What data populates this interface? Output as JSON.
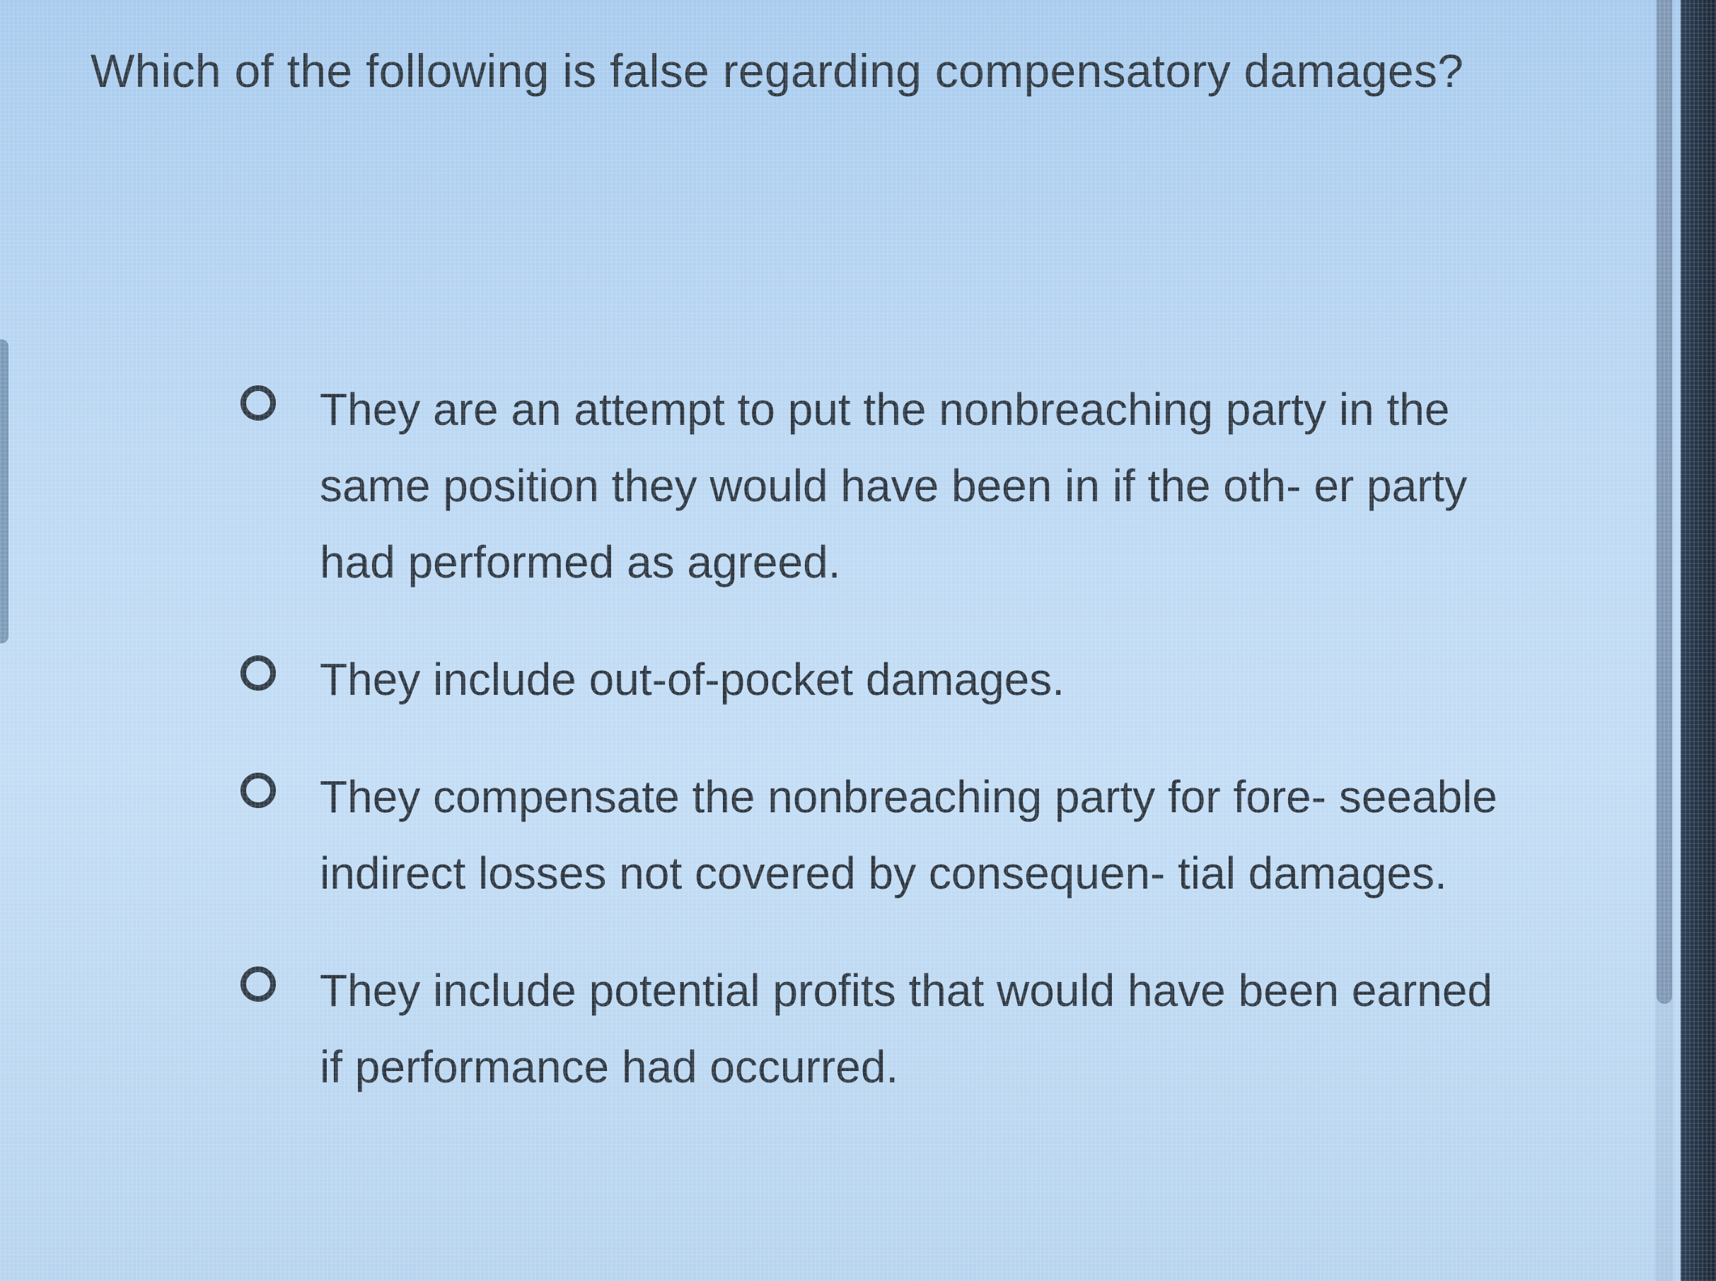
{
  "question": "Which of the following is false regarding compensatory damages?",
  "options": [
    {
      "label": "They are an attempt to put the nonbreaching party in the same position they would have been in if the oth- er party had performed as agreed."
    },
    {
      "label": "They include out-of-pocket damages."
    },
    {
      "label": "They compensate the nonbreaching party for fore- seeable indirect losses not covered by consequen- tial damages."
    },
    {
      "label": "They include potential profits that would have been earned if performance had occurred."
    }
  ],
  "colors": {
    "background": "#bcd8f3",
    "text": "#2f3942",
    "radio_border": "#303b45"
  },
  "icons": {
    "radio": "radio-unchecked-icon"
  }
}
